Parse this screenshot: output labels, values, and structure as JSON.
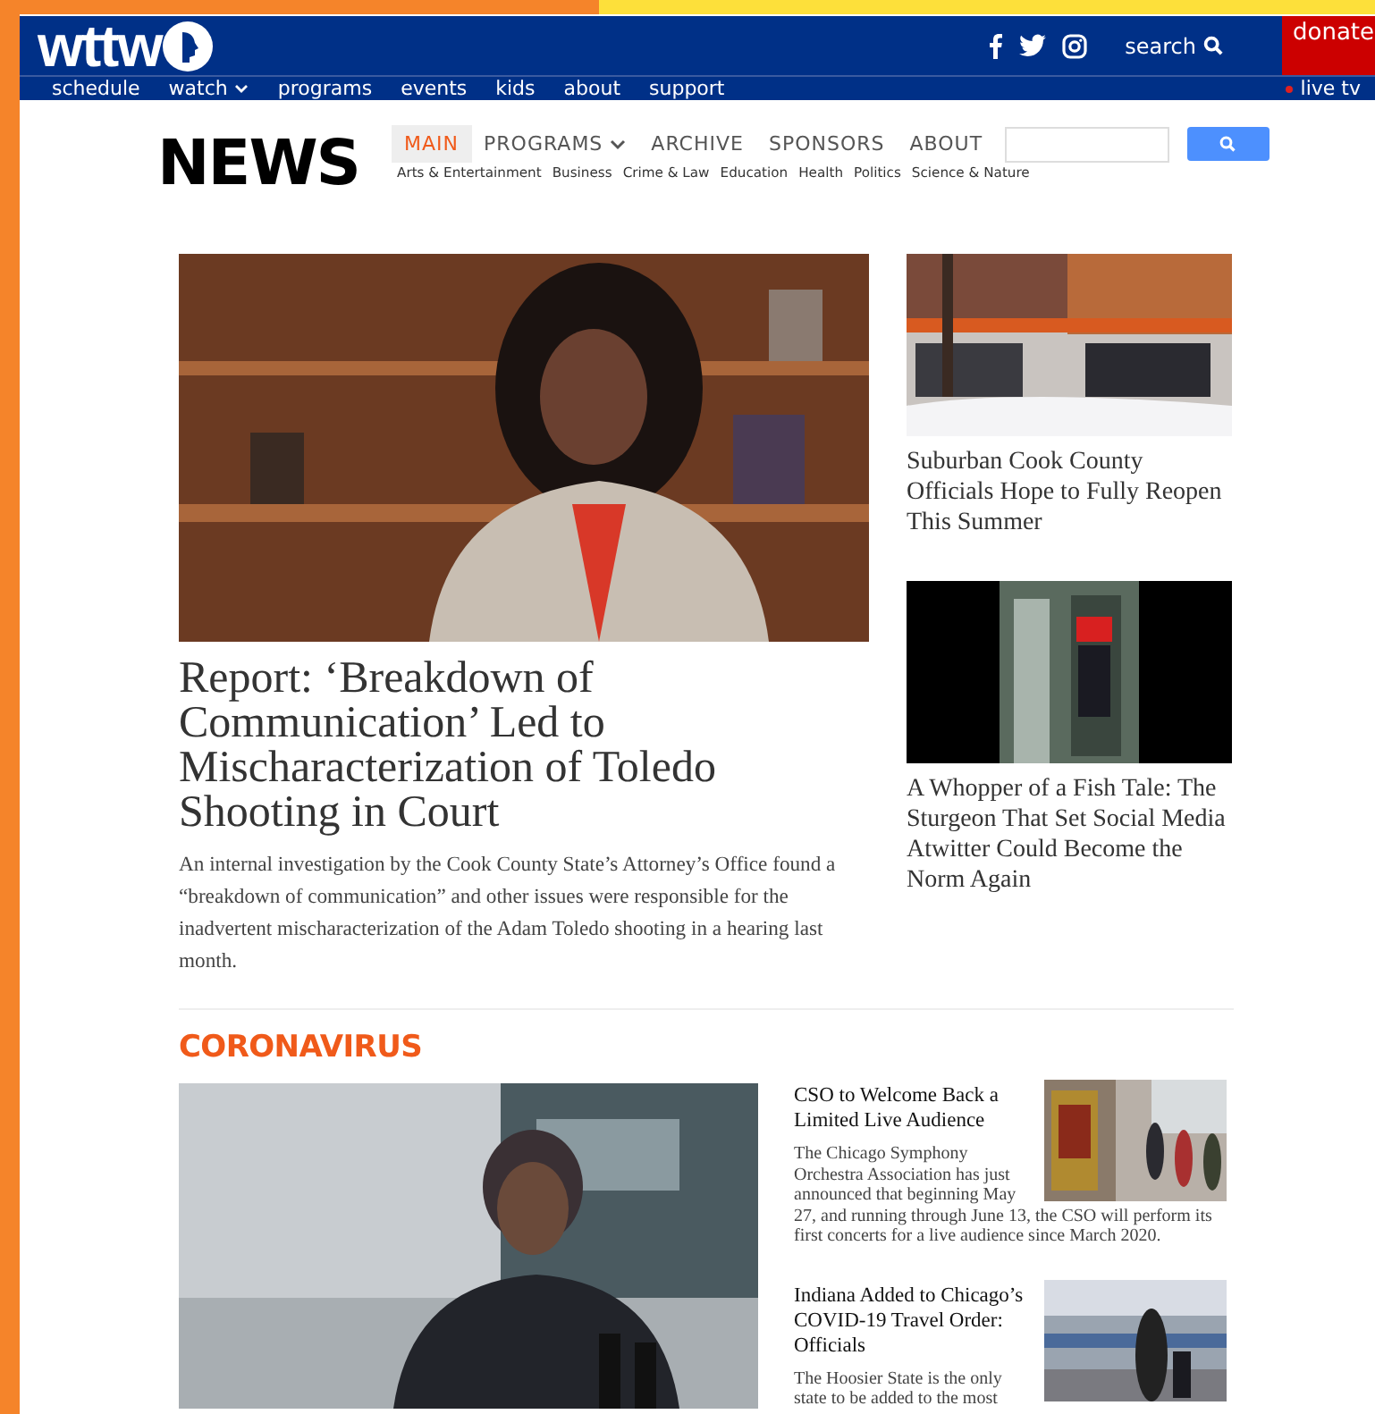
{
  "header": {
    "logo": "wttw",
    "search_label": "search",
    "donate": "donate"
  },
  "nav": {
    "items": [
      {
        "label": "schedule",
        "caret": false
      },
      {
        "label": "watch",
        "caret": true
      },
      {
        "label": "programs",
        "caret": false
      },
      {
        "label": "events",
        "caret": false
      },
      {
        "label": "kids",
        "caret": false
      },
      {
        "label": "about",
        "caret": false
      },
      {
        "label": "support",
        "caret": false
      }
    ],
    "live": "live tv"
  },
  "news": {
    "title": "NEWS",
    "tabs": [
      {
        "label": "MAIN",
        "selected": true,
        "caret": false
      },
      {
        "label": "PROGRAMS",
        "selected": false,
        "caret": true
      },
      {
        "label": "ARCHIVE",
        "selected": false,
        "caret": false
      },
      {
        "label": "SPONSORS",
        "selected": false,
        "caret": false
      },
      {
        "label": "ABOUT",
        "selected": false,
        "caret": false
      }
    ],
    "categories": [
      "Arts & Entertainment",
      "Business",
      "Crime & Law",
      "Education",
      "Health",
      "Politics",
      "Science & Nature"
    ]
  },
  "lead": {
    "headline": "Report: ‘Breakdown of Communication’ Led to Mischaracterization of Toledo Shooting in Court",
    "summary": "An internal investigation by the Cook County State’s Attorney’s Office found a “breakdown of communication” and other issues were responsible for the inadvertent mischaracterization of the Adam Toledo shooting in a hearing last month."
  },
  "side_stories": [
    {
      "headline": "Suburban Cook County Officials Hope to Fully Reopen This Summer"
    },
    {
      "headline": "A Whopper of a Fish Tale: The Sturgeon That Set Social Media Atwitter Could Become the Norm Again"
    }
  ],
  "section": {
    "heading": "CORONAVIRUS",
    "stories": [
      {
        "headline": "CSO to Welcome Back a Limited Live Audience",
        "summary": "The Chicago Symphony Orchestra Association has just announced that beginning May 27, and running through June 13, the CSO will perform its first concerts for a live audience since March 2020."
      },
      {
        "headline": "Indiana Added to Chicago’s COVID-19 Travel Order: Officials",
        "summary": "The Hoosier State is the only state to be added to the most"
      }
    ]
  }
}
